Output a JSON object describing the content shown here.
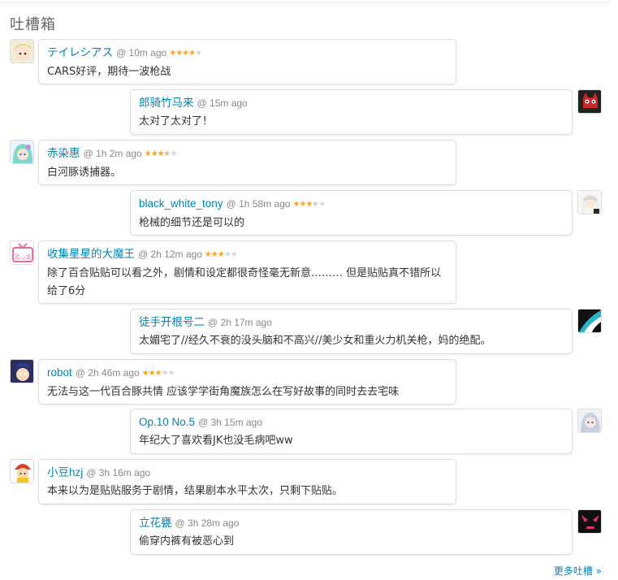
{
  "section": {
    "title": "吐槽箱"
  },
  "comments": [
    {
      "user": "テイレシアス",
      "time": "@ 10m ago",
      "stars": 4,
      "text": "CARS好评，期待一波枪战",
      "avatar": "blonde-girl-avatar"
    },
    {
      "user": "郎骑竹马来",
      "time": "@ 15m ago",
      "stars": 0,
      "text": "太对了太对了！",
      "avatar": "red-cat-avatar"
    },
    {
      "user": "赤染惠",
      "time": "@ 1h 2m ago",
      "stars": 3.5,
      "text": "白河豚诱捕器。",
      "avatar": "teal-hair-girl-avatar"
    },
    {
      "user": "black_white_tony",
      "time": "@ 1h 58m ago",
      "stars": 3.5,
      "text": "枪械的细节还是可以的",
      "avatar": "white-hair-girl-avatar"
    },
    {
      "user": "收集星星的大魔王",
      "time": "@ 2h 12m ago",
      "stars": 3,
      "text": "除了百合贴贴可以看之外，剧情和设定都很奇怪毫无新意……… 但是贴贴真不错所以给了6分",
      "avatar": "pink-tv-avatar"
    },
    {
      "user": "徒手开根号二",
      "time": "@ 2h 17m ago",
      "stars": 0,
      "text": "太媚宅了//经久不衰的没头脑和不高兴//美少女和重火力机关枪，妈的绝配。",
      "avatar": "teal-abstract-avatar"
    },
    {
      "user": "robot",
      "time": "@ 2h 46m ago",
      "stars": 3,
      "text": "无法与这一代百合豚共情 应该学学街角魔族怎么在写好故事的同时去去宅味",
      "avatar": "blue-hair-boy-avatar"
    },
    {
      "user": "Op.10 No.5",
      "time": "@ 3h 15m ago",
      "stars": 0,
      "text": "年纪大了喜欢看JK也没毛病吧ww",
      "avatar": "silver-hair-girl-avatar"
    },
    {
      "user": "小豆hzj",
      "time": "@ 3h 16m ago",
      "stars": 0,
      "text": "本来以为是贴贴服务于剧情，结果剧本水平太次，只剩下贴贴。",
      "avatar": "yellow-character-avatar"
    },
    {
      "user": "立花甕",
      "time": "@ 3h 28m ago",
      "stars": 0,
      "text": "偷穿内裤有被恶心到",
      "avatar": "dark-creature-avatar"
    }
  ],
  "footer": {
    "more_label": "更多吐槽 »"
  },
  "colors": {
    "link": "#0084b4",
    "star": "#f5a623",
    "border": "#dddddd"
  }
}
